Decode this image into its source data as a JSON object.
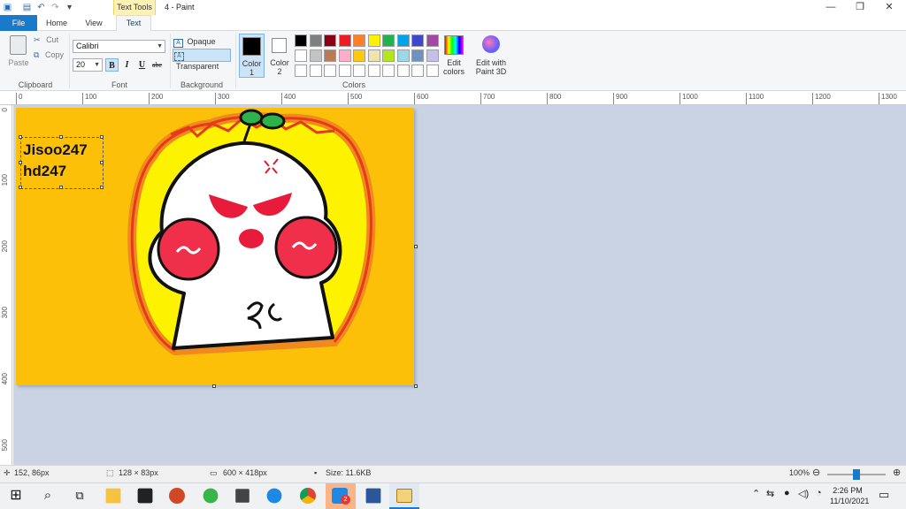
{
  "window": {
    "context_tab": "Text Tools",
    "title": "4 - Paint"
  },
  "tabs": [
    "File",
    "Home",
    "View",
    "Text"
  ],
  "ribbon": {
    "clipboard": {
      "paste": "Paste",
      "cut": "Cut",
      "copy": "Copy",
      "label": "Clipboard"
    },
    "font": {
      "family": "Calibri",
      "size": "20",
      "bold": "B",
      "italic": "I",
      "underline": "U",
      "strike": "abc",
      "label": "Font"
    },
    "background": {
      "opaque": "Opaque",
      "transparent": "Transparent",
      "label": "Background"
    },
    "colors": {
      "color1": "Color 1",
      "color2": "Color 2",
      "edit": "Edit colors",
      "paint3d": "Edit with Paint 3D",
      "label": "Colors",
      "palette": [
        "#000000",
        "#7f7f7f",
        "#880015",
        "#ed1c24",
        "#ff7f27",
        "#fff200",
        "#22b14c",
        "#00a2e8",
        "#3f48cc",
        "#a349a4",
        "#ffffff",
        "#c3c3c3",
        "#b97a57",
        "#ffaec9",
        "#ffc90e",
        "#efe4b0",
        "#b5e61d",
        "#99d9ea",
        "#7092be",
        "#c8bfe7",
        "#ffffff",
        "#ffffff",
        "#ffffff",
        "#ffffff",
        "#ffffff",
        "#ffffff",
        "#ffffff",
        "#ffffff",
        "#ffffff",
        "#ffffff"
      ]
    }
  },
  "ruler": {
    "h": [
      "0",
      "100",
      "200",
      "300",
      "400",
      "500",
      "600",
      "700",
      "800",
      "900",
      "1000",
      "1100",
      "1200",
      "1300"
    ],
    "v": [
      "0",
      "100",
      "200",
      "300",
      "400",
      "500"
    ]
  },
  "canvas": {
    "text_line1": "Jisoo247",
    "text_line2": "hd247",
    "background_color": "#fcc008"
  },
  "status": {
    "cursor": "152, 86px",
    "selection": "128 × 83px",
    "image_size": "600 × 418px",
    "file_size": "Size: 11.6KB",
    "zoom": "100%",
    "zoom_level": 0.5
  },
  "taskbar": {
    "time": "2:26 PM",
    "date": "11/10/2021",
    "mail_badge": "2"
  }
}
